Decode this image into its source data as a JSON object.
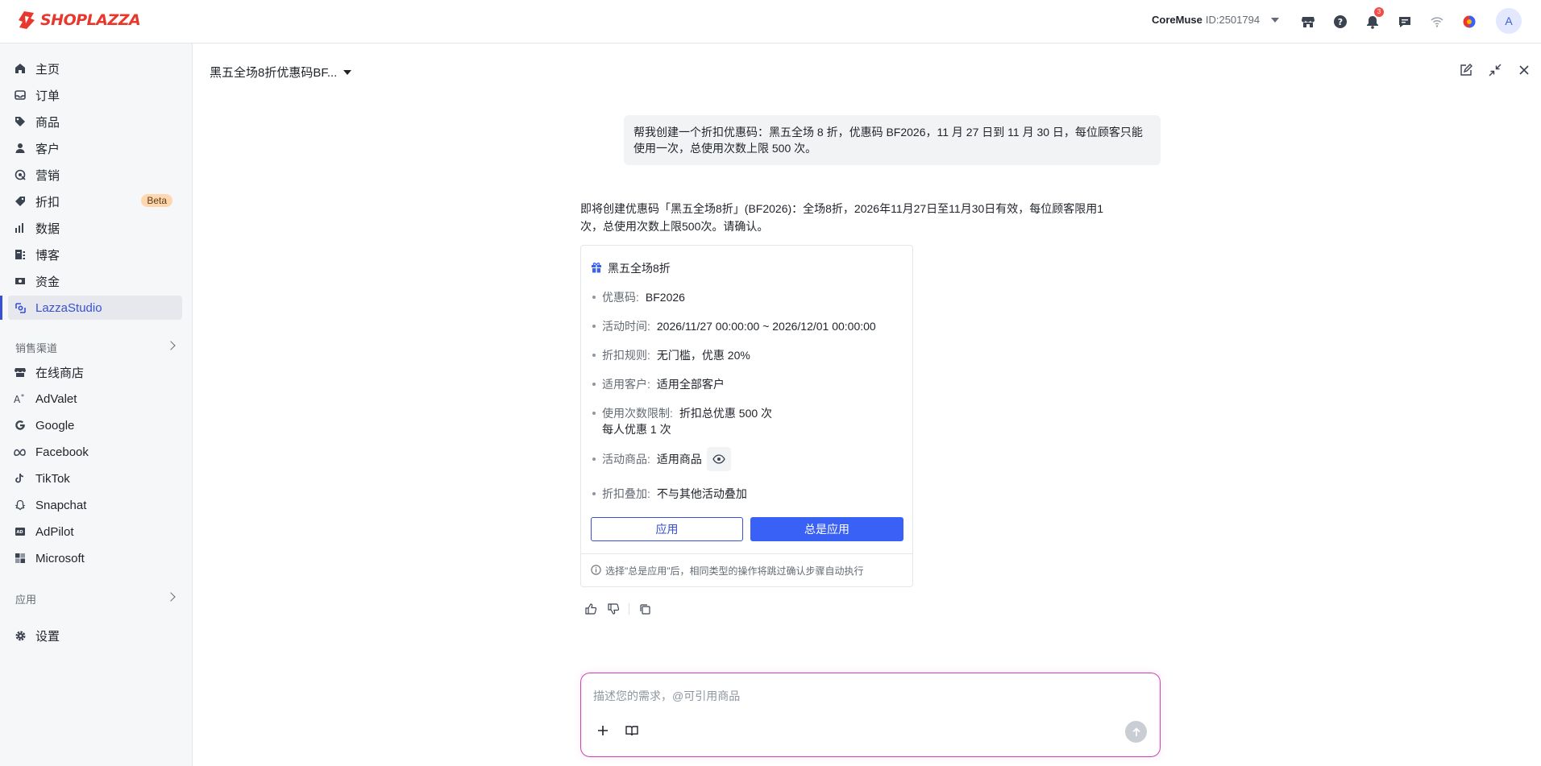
{
  "topbar": {
    "brand": "SHOPLAZZA",
    "store_name": "CoreMuse",
    "store_id": "ID:2501794",
    "notification_count": "3",
    "avatar_initial": "A"
  },
  "sidebar": {
    "items": [
      {
        "label": "主页",
        "icon": "home-icon"
      },
      {
        "label": "订单",
        "icon": "inbox-icon"
      },
      {
        "label": "商品",
        "icon": "tag-icon"
      },
      {
        "label": "客户",
        "icon": "user-icon"
      },
      {
        "label": "营销",
        "icon": "target-icon"
      },
      {
        "label": "折扣",
        "icon": "discount-icon",
        "badge": "Beta"
      },
      {
        "label": "数据",
        "icon": "bar-chart-icon"
      },
      {
        "label": "博客",
        "icon": "blog-icon"
      },
      {
        "label": "资金",
        "icon": "money-icon"
      },
      {
        "label": "LazzaStudio",
        "icon": "studio-icon",
        "active": true
      }
    ],
    "sales_channels_title": "销售渠道",
    "channels": [
      {
        "label": "在线商店",
        "icon": "store-icon"
      },
      {
        "label": "AdValet",
        "icon": "advalet-icon"
      },
      {
        "label": "Google",
        "icon": "google-icon"
      },
      {
        "label": "Facebook",
        "icon": "meta-icon"
      },
      {
        "label": "TikTok",
        "icon": "tiktok-icon"
      },
      {
        "label": "Snapchat",
        "icon": "snapchat-icon"
      },
      {
        "label": "AdPilot",
        "icon": "adpilot-icon"
      },
      {
        "label": "Microsoft",
        "icon": "microsoft-icon"
      }
    ],
    "apps_title": "应用",
    "settings_label": "设置"
  },
  "conversation": {
    "title": "黑五全场8折优惠码BF...",
    "user_message": "帮我创建一个折扣优惠码：黑五全场 8 折，优惠码 BF2026，11 月 27 日到 11 月 30 日，每位顾客只能使用一次，总使用次数上限 500 次。",
    "assistant_message": "即将创建优惠码「黑五全场8折」(BF2026)：全场8折，2026年11月27日至11月30日有效，每位顾客限用1次，总使用次数上限500次。请确认。"
  },
  "card": {
    "title": "黑五全场8折",
    "rows": [
      {
        "key": "优惠码:",
        "value": "BF2026"
      },
      {
        "key": "活动时间:",
        "value": "2026/11/27 00:00:00 ~ 2026/12/01 00:00:00"
      },
      {
        "key": "折扣规则:",
        "value": "无门槛，优惠 20%"
      },
      {
        "key": "适用客户:",
        "value": "适用全部客户"
      },
      {
        "key": "使用次数限制:",
        "value": "折扣总优惠 500 次",
        "value2": "每人优惠 1 次"
      },
      {
        "key": "活动商品:",
        "value": "适用商品"
      },
      {
        "key": "折扣叠加:",
        "value": "不与其他活动叠加"
      }
    ],
    "apply_label": "应用",
    "always_apply_label": "总是应用",
    "footer_note": "选择\"总是应用\"后，相同类型的操作将跳过确认步骤自动执行"
  },
  "composer": {
    "placeholder": "描述您的需求，@可引用商品",
    "value": ""
  },
  "colors": {
    "accent": "#3a61f5",
    "brand_red": "#e8372c",
    "composer_border": "#d43fb8"
  }
}
